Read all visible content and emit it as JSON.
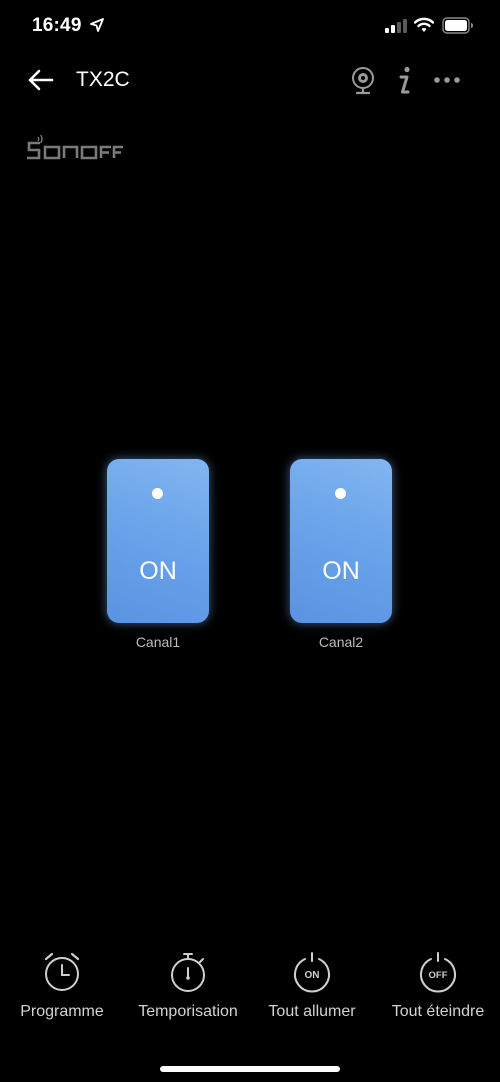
{
  "status_bar": {
    "time": "16:49",
    "location_icon": "location-arrow-icon",
    "signal_icon": "cellular-signal-icon",
    "wifi_icon": "wifi-icon",
    "battery_icon": "battery-icon"
  },
  "header": {
    "back_icon": "back-arrow-icon",
    "title": "TX2C",
    "camera_icon": "camera-icon",
    "info_icon": "info-icon",
    "more_icon": "more-dots-icon"
  },
  "brand": {
    "logo_text": "SONOFF"
  },
  "channels": [
    {
      "state": "ON",
      "label": "Canal1"
    },
    {
      "state": "ON",
      "label": "Canal2"
    }
  ],
  "toolbar": [
    {
      "label": "Programme",
      "icon": "alarm-clock-icon"
    },
    {
      "label": "Temporisation",
      "icon": "stopwatch-icon"
    },
    {
      "label": "Tout allumer",
      "icon": "power-on-icon",
      "icon_text": "ON"
    },
    {
      "label": "Tout éteindre",
      "icon": "power-off-icon",
      "icon_text": "OFF"
    }
  ],
  "colors": {
    "background": "#000000",
    "switch_on": "#6aa4ea",
    "text_primary": "#ffffff",
    "text_secondary": "#bcbcbc"
  }
}
